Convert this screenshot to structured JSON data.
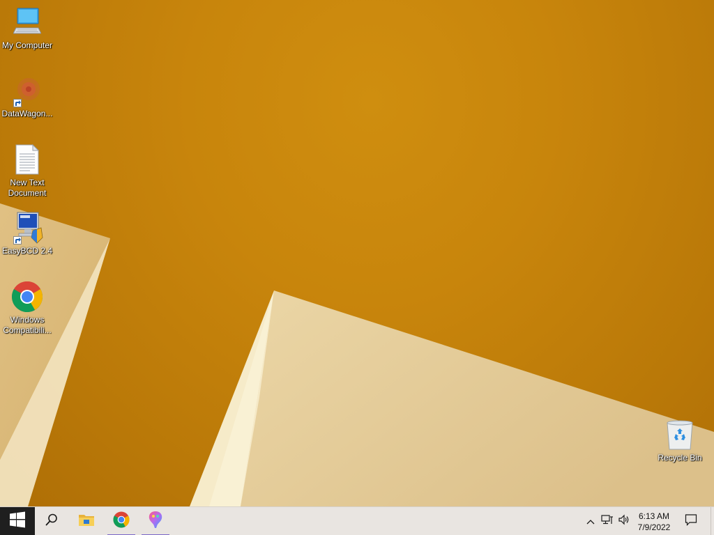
{
  "desktop": {
    "icons": [
      {
        "label": "My Computer",
        "icon": "computer-icon"
      },
      {
        "label": "DataWagon...",
        "icon": "datawagon-icon"
      },
      {
        "label": "New Text\nDocument",
        "icon": "text-document-icon"
      },
      {
        "label": "EasyBCD 2.4",
        "icon": "easybcd-icon"
      },
      {
        "label": "Windows\nCompatibili...",
        "icon": "chrome-icon"
      },
      {
        "label": "Recycle Bin",
        "icon": "recycle-bin-icon"
      }
    ]
  },
  "taskbar": {
    "pinned": [
      {
        "name": "start",
        "icon": "windows-logo-icon"
      },
      {
        "name": "search",
        "icon": "search-icon"
      },
      {
        "name": "file-explorer",
        "icon": "folder-icon"
      },
      {
        "name": "chrome",
        "icon": "chrome-icon",
        "running": true
      },
      {
        "name": "paint",
        "icon": "paint-app-icon",
        "running": true
      }
    ],
    "tray": {
      "icons": [
        "chevron-up-icon",
        "network-icon",
        "volume-icon"
      ],
      "time": "6:13 AM",
      "date": "7/9/2022",
      "notification_icon": "action-center-icon"
    }
  },
  "colors": {
    "wallpaper": "#c8850c",
    "wallpaper_light": "#e8d4a0",
    "taskbar": "#e9e5e1",
    "running_indicator": "#7a66c8"
  }
}
